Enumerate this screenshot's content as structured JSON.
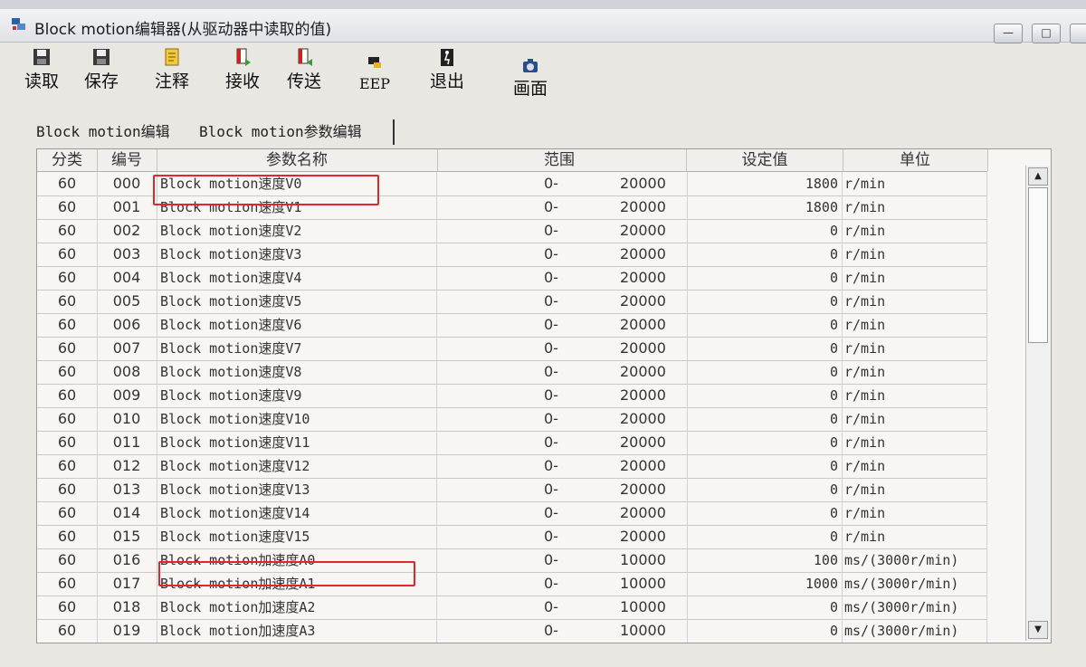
{
  "window": {
    "title": "Block motion编辑器(从驱动器中读取的值)"
  },
  "toolbar": {
    "items": [
      {
        "label": "读取",
        "icon": "floppy-disk-icon"
      },
      {
        "label": "保存",
        "icon": "floppy-disk-icon"
      },
      {
        "label": "注释",
        "icon": "note-icon"
      },
      {
        "label": "接收",
        "icon": "receive-icon"
      },
      {
        "label": "传送",
        "icon": "send-icon"
      },
      {
        "label": "EEP",
        "icon": "eep-icon"
      },
      {
        "label": "退出",
        "icon": "exit-door-icon"
      },
      {
        "label": "画面",
        "icon": "camera-icon"
      }
    ]
  },
  "tabs": [
    {
      "label": "Block motion编辑"
    },
    {
      "label": "Block motion参数编辑"
    }
  ],
  "table": {
    "headers": {
      "category": "分类",
      "number": "编号",
      "name": "参数名称",
      "range": "范围",
      "value": "设定值",
      "unit": "单位"
    },
    "rows": [
      {
        "cat": "60",
        "num": "000",
        "name": "Block motion速度V0",
        "lo": "0-",
        "hi": "20000",
        "val": "1800",
        "unit": "r/min"
      },
      {
        "cat": "60",
        "num": "001",
        "name": "Block motion速度V1",
        "lo": "0-",
        "hi": "20000",
        "val": "1800",
        "unit": "r/min"
      },
      {
        "cat": "60",
        "num": "002",
        "name": "Block motion速度V2",
        "lo": "0-",
        "hi": "20000",
        "val": "0",
        "unit": "r/min"
      },
      {
        "cat": "60",
        "num": "003",
        "name": "Block motion速度V3",
        "lo": "0-",
        "hi": "20000",
        "val": "0",
        "unit": "r/min"
      },
      {
        "cat": "60",
        "num": "004",
        "name": "Block motion速度V4",
        "lo": "0-",
        "hi": "20000",
        "val": "0",
        "unit": "r/min"
      },
      {
        "cat": "60",
        "num": "005",
        "name": "Block motion速度V5",
        "lo": "0-",
        "hi": "20000",
        "val": "0",
        "unit": "r/min"
      },
      {
        "cat": "60",
        "num": "006",
        "name": "Block motion速度V6",
        "lo": "0-",
        "hi": "20000",
        "val": "0",
        "unit": "r/min"
      },
      {
        "cat": "60",
        "num": "007",
        "name": "Block motion速度V7",
        "lo": "0-",
        "hi": "20000",
        "val": "0",
        "unit": "r/min"
      },
      {
        "cat": "60",
        "num": "008",
        "name": "Block motion速度V8",
        "lo": "0-",
        "hi": "20000",
        "val": "0",
        "unit": "r/min"
      },
      {
        "cat": "60",
        "num": "009",
        "name": "Block motion速度V9",
        "lo": "0-",
        "hi": "20000",
        "val": "0",
        "unit": "r/min"
      },
      {
        "cat": "60",
        "num": "010",
        "name": "Block motion速度V10",
        "lo": "0-",
        "hi": "20000",
        "val": "0",
        "unit": "r/min"
      },
      {
        "cat": "60",
        "num": "011",
        "name": "Block motion速度V11",
        "lo": "0-",
        "hi": "20000",
        "val": "0",
        "unit": "r/min"
      },
      {
        "cat": "60",
        "num": "012",
        "name": "Block motion速度V12",
        "lo": "0-",
        "hi": "20000",
        "val": "0",
        "unit": "r/min"
      },
      {
        "cat": "60",
        "num": "013",
        "name": "Block motion速度V13",
        "lo": "0-",
        "hi": "20000",
        "val": "0",
        "unit": "r/min"
      },
      {
        "cat": "60",
        "num": "014",
        "name": "Block motion速度V14",
        "lo": "0-",
        "hi": "20000",
        "val": "0",
        "unit": "r/min"
      },
      {
        "cat": "60",
        "num": "015",
        "name": "Block motion速度V15",
        "lo": "0-",
        "hi": "20000",
        "val": "0",
        "unit": "r/min"
      },
      {
        "cat": "60",
        "num": "016",
        "name": "Block motion加速度A0",
        "lo": "0-",
        "hi": "10000",
        "val": "100",
        "unit": "ms/(3000r/min)"
      },
      {
        "cat": "60",
        "num": "017",
        "name": "Block motion加速度A1",
        "lo": "0-",
        "hi": "10000",
        "val": "1000",
        "unit": "ms/(3000r/min)"
      },
      {
        "cat": "60",
        "num": "018",
        "name": "Block motion加速度A2",
        "lo": "0-",
        "hi": "10000",
        "val": "0",
        "unit": "ms/(3000r/min)"
      },
      {
        "cat": "60",
        "num": "019",
        "name": "Block motion加速度A3",
        "lo": "0-",
        "hi": "10000",
        "val": "0",
        "unit": "ms/(3000r/min)"
      }
    ]
  },
  "colors": {
    "highlight": "#e0282c",
    "grid_bg": "#f7f6f3",
    "window_bg": "#e9e7e2"
  }
}
